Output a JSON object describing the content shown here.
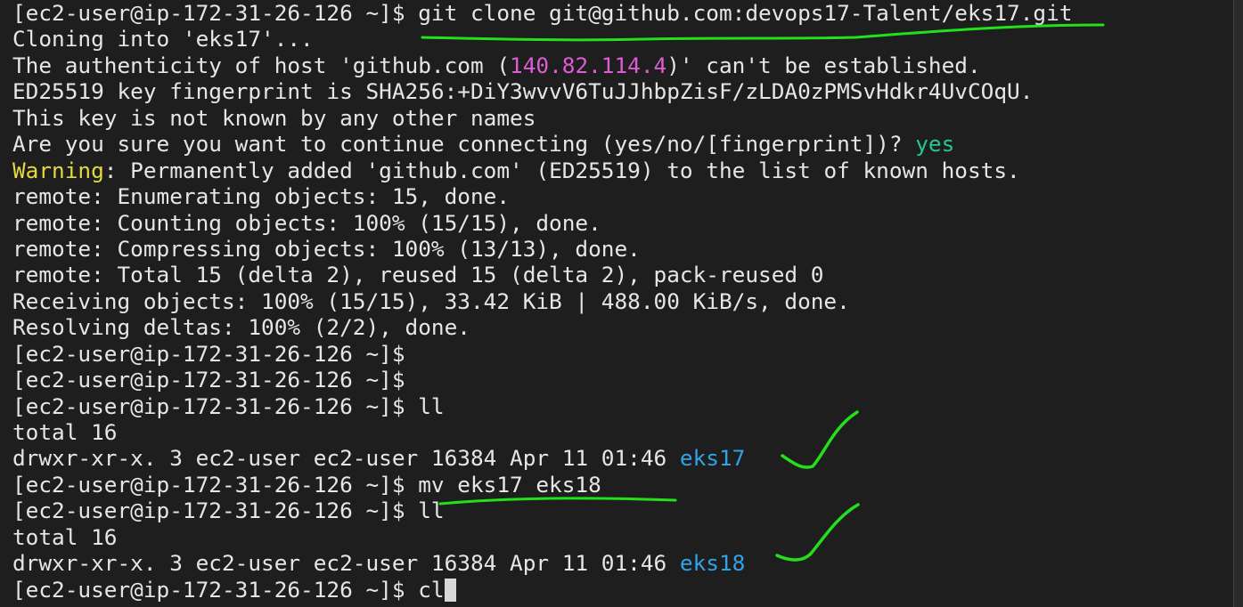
{
  "terminal": {
    "lines": [
      [
        {
          "text": "[ec2-user@ip-172-31-26-126 ~]$ git clone git@github.com:devops17-Talent/eks17.git",
          "color": "plain"
        }
      ],
      [
        {
          "text": "Cloning into 'eks17'...",
          "color": "plain"
        }
      ],
      [
        {
          "text": "The authenticity of host 'github.com (",
          "color": "plain"
        },
        {
          "text": "140.82.114.4",
          "color": "magenta"
        },
        {
          "text": ")' can't be established.",
          "color": "plain"
        }
      ],
      [
        {
          "text": "ED25519 key fingerprint is SHA256:+DiY3wvvV6TuJJhbpZisF/zLDA0zPMSvHdkr4UvCOqU.",
          "color": "plain"
        }
      ],
      [
        {
          "text": "This key is not known by any other names",
          "color": "plain"
        }
      ],
      [
        {
          "text": "Are you sure you want to continue connecting (yes/no/[fingerprint])? ",
          "color": "plain"
        },
        {
          "text": "yes",
          "color": "green"
        }
      ],
      [
        {
          "text": "Warning",
          "color": "yellow"
        },
        {
          "text": ": Permanently added 'github.com' (ED25519) to the list of known hosts.",
          "color": "plain"
        }
      ],
      [
        {
          "text": "remote: Enumerating objects: 15, done.",
          "color": "plain"
        }
      ],
      [
        {
          "text": "remote: Counting objects: 100% (15/15), done.",
          "color": "plain"
        }
      ],
      [
        {
          "text": "remote: Compressing objects: 100% (13/13), done.",
          "color": "plain"
        }
      ],
      [
        {
          "text": "remote: Total 15 (delta 2), reused 15 (delta 2), pack-reused 0",
          "color": "plain"
        }
      ],
      [
        {
          "text": "Receiving objects: 100% (15/15), 33.42 KiB | 488.00 KiB/s, done.",
          "color": "plain"
        }
      ],
      [
        {
          "text": "Resolving deltas: 100% (2/2), done.",
          "color": "plain"
        }
      ],
      [
        {
          "text": "[ec2-user@ip-172-31-26-126 ~]$",
          "color": "plain"
        }
      ],
      [
        {
          "text": "[ec2-user@ip-172-31-26-126 ~]$",
          "color": "plain"
        }
      ],
      [
        {
          "text": "[ec2-user@ip-172-31-26-126 ~]$ ll",
          "color": "plain"
        }
      ],
      [
        {
          "text": "total 16",
          "color": "plain"
        }
      ],
      [
        {
          "text": "drwxr-xr-x. 3 ec2-user ec2-user 16384 Apr 11 01:46 ",
          "color": "plain"
        },
        {
          "text": "eks17",
          "color": "blue"
        }
      ],
      [
        {
          "text": "[ec2-user@ip-172-31-26-126 ~]$ mv eks17 eks18",
          "color": "plain"
        }
      ],
      [
        {
          "text": "[ec2-user@ip-172-31-26-126 ~]$ ll",
          "color": "plain"
        }
      ],
      [
        {
          "text": "total 16",
          "color": "plain"
        }
      ],
      [
        {
          "text": "drwxr-xr-x. 3 ec2-user ec2-user 16384 Apr 11 01:46 ",
          "color": "plain"
        },
        {
          "text": "eks18",
          "color": "blue"
        }
      ],
      [
        {
          "text": "[ec2-user@ip-172-31-26-126 ~]$ cl",
          "color": "plain"
        }
      ]
    ],
    "cursor_visible": true
  },
  "colors": {
    "background": "#1e1e1e",
    "text": "#e6e6e6",
    "magenta": "#e05bd6",
    "green": "#23c88c",
    "yellow": "#e5d93f",
    "blue": "#2fa4e8",
    "annotation": "#22e01a"
  }
}
